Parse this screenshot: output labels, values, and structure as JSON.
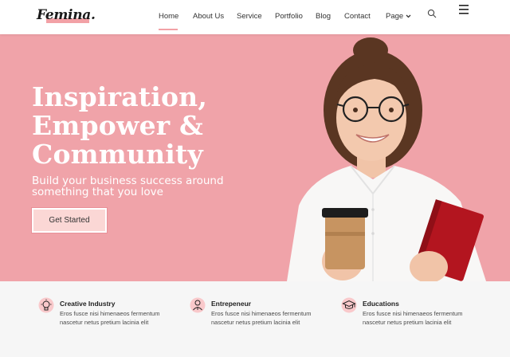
{
  "header": {
    "logo": "Femina.",
    "nav": [
      {
        "label": "Home",
        "active": true
      },
      {
        "label": "About Us"
      },
      {
        "label": "Service"
      },
      {
        "label": "Portfolio"
      },
      {
        "label": "Blog"
      },
      {
        "label": "Contact"
      },
      {
        "label": "Page"
      }
    ]
  },
  "hero": {
    "title_lines": [
      "Inspiration,",
      "Empower &",
      "Community"
    ],
    "subtitle": "Build your business success around something that you love",
    "cta_label": "Get Started"
  },
  "features": [
    {
      "title": "Creative Industry",
      "text": "Eros fusce nisi himenaeos fermentum nascetur netus pretium lacinia elit",
      "icon": "lightbulb-icon"
    },
    {
      "title": "Entrepeneur",
      "text": "Eros fusce nisi himenaeos fermentum nascetur netus pretium lacinia elit",
      "icon": "person-icon"
    },
    {
      "title": "Educations",
      "text": "Eros fusce nisi himenaeos fermentum nascetur netus pretium lacinia elit",
      "icon": "graduation-cap-icon"
    }
  ],
  "colors": {
    "brand_pink": "#f0a3a9",
    "accent": "#f2a1a6",
    "button_fill": "#fbd7d5"
  }
}
